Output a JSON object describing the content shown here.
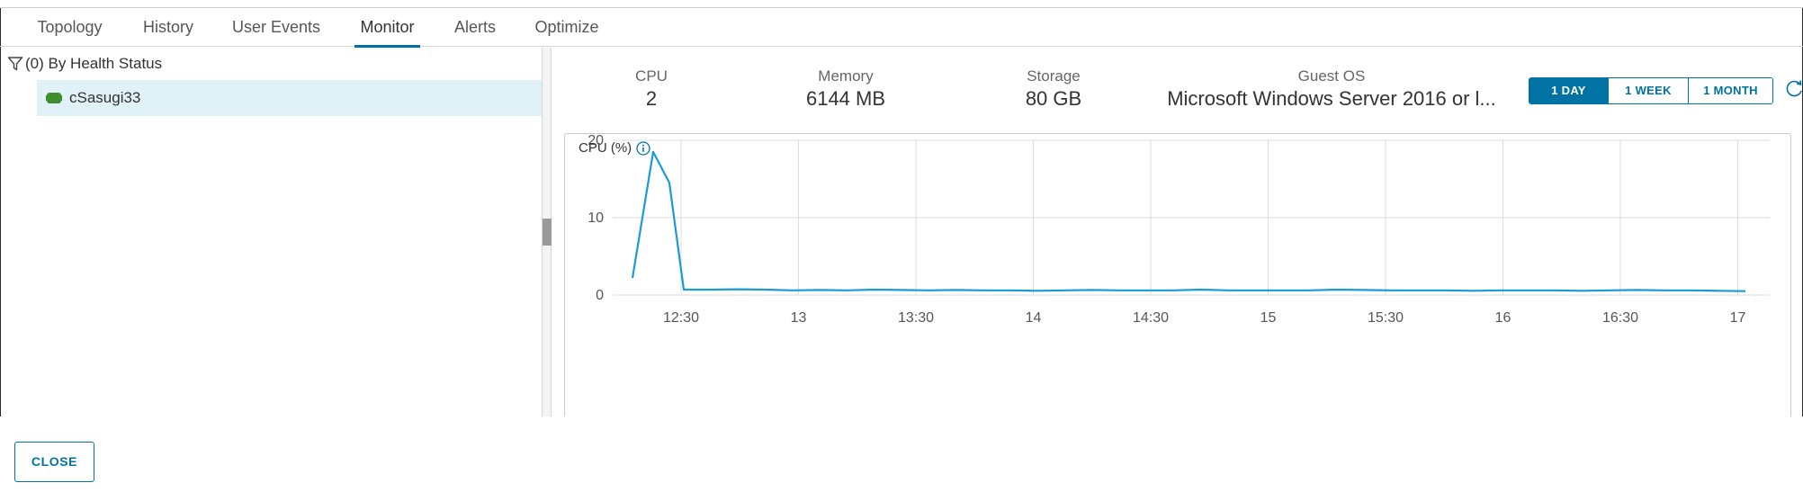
{
  "tabs": [
    {
      "label": "Topology"
    },
    {
      "label": "History"
    },
    {
      "label": "User Events"
    },
    {
      "label": "Monitor",
      "active": true
    },
    {
      "label": "Alerts"
    },
    {
      "label": "Optimize"
    }
  ],
  "filter": {
    "label": "(0) By Health Status"
  },
  "tree": {
    "item_label": "cSasugi33",
    "status_color": "#3f8f2f"
  },
  "summary": {
    "cpu": {
      "label": "CPU",
      "value": "2"
    },
    "memory": {
      "label": "Memory",
      "value": "6144 MB"
    },
    "storage": {
      "label": "Storage",
      "value": "80 GB"
    },
    "guest_os": {
      "label": "Guest OS",
      "value": "Microsoft Windows Server 2016 or l..."
    }
  },
  "time_range": {
    "options": [
      "1 DAY",
      "1 WEEK",
      "1 MONTH"
    ],
    "selected": "1 DAY"
  },
  "chart_title": "CPU (%)",
  "chart_data": {
    "type": "line",
    "title": "CPU (%)",
    "xlabel": "",
    "ylabel": "",
    "ylim": [
      0,
      20
    ],
    "yticks": [
      "0",
      "10",
      "20"
    ],
    "xticks": [
      "12:30",
      "13",
      "13:30",
      "14",
      "14:30",
      "15",
      "15:30",
      "16",
      "16:30",
      "17"
    ],
    "grid": true,
    "series_color": "#1a9bd7",
    "series": [
      {
        "values": [
          2.2,
          18.5,
          14.5,
          0.7,
          0.7,
          0.75,
          0.7,
          0.6,
          0.65,
          0.6,
          0.7,
          0.65,
          0.6,
          0.65,
          0.6,
          0.6,
          0.55,
          0.6,
          0.65,
          0.6,
          0.6,
          0.6,
          0.7,
          0.6,
          0.6,
          0.6,
          0.6,
          0.7,
          0.65,
          0.6,
          0.6,
          0.6,
          0.55,
          0.6,
          0.6,
          0.6,
          0.55,
          0.6,
          0.65,
          0.6,
          0.6,
          0.55,
          0.5
        ]
      }
    ]
  },
  "footer": {
    "close_label": "CLOSE"
  },
  "accent_color": "#0072a3"
}
